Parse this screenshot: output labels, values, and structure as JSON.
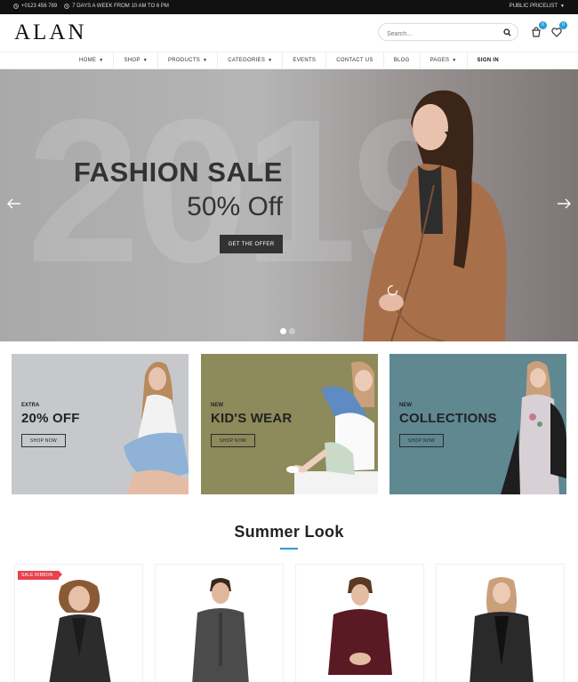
{
  "topbar": {
    "phone": "+0123 456 789",
    "hours": "7 DAYS A WEEK FROM 10 AM TO 6 PM",
    "pricelist": "PUBLIC PRICELIST"
  },
  "header": {
    "logo": "ALAN",
    "search_placeholder": "Search...",
    "cart_count": "0",
    "wishlist_count": "0"
  },
  "nav": {
    "items": [
      {
        "label": "HOME",
        "dropdown": true
      },
      {
        "label": "SHOP",
        "dropdown": true
      },
      {
        "label": "PRODUCTS",
        "dropdown": true
      },
      {
        "label": "CATEGORIES",
        "dropdown": true
      },
      {
        "label": "EVENTS",
        "dropdown": false
      },
      {
        "label": "CONTACT US",
        "dropdown": false
      },
      {
        "label": "BLOG",
        "dropdown": false
      },
      {
        "label": "PAGES",
        "dropdown": true
      },
      {
        "label": "SIGN IN",
        "dropdown": false
      }
    ]
  },
  "hero": {
    "background_number": "2019",
    "title": "FASHION SALE",
    "subtitle": "50% Off",
    "button": "GET THE OFFER",
    "slide_count": 2,
    "active_slide": 1
  },
  "banners": [
    {
      "small": "EXTRA",
      "big": "20% OFF",
      "button": "SHOP NOW"
    },
    {
      "small": "NEW",
      "big": "KID'S WEAR",
      "button": "SHOP NOW"
    },
    {
      "small": "NEW",
      "big": "COLLECTIONS",
      "button": "SHOP NOW"
    }
  ],
  "section": {
    "title": "Summer Look"
  },
  "products": [
    {
      "ribbon": "SALE RIBBON"
    },
    {
      "ribbon": ""
    },
    {
      "ribbon": ""
    },
    {
      "ribbon": ""
    }
  ],
  "icons": {
    "phone": "phone-icon",
    "clock": "clock-icon",
    "search": "search-icon",
    "cart": "cart-icon",
    "wishlist": "heart-icon",
    "prev": "arrow-left-icon",
    "next": "arrow-right-icon"
  },
  "colors": {
    "accent": "#2b9ad8",
    "ribbon": "#e8414b",
    "topbar": "#111111",
    "hero_button": "#333333"
  }
}
